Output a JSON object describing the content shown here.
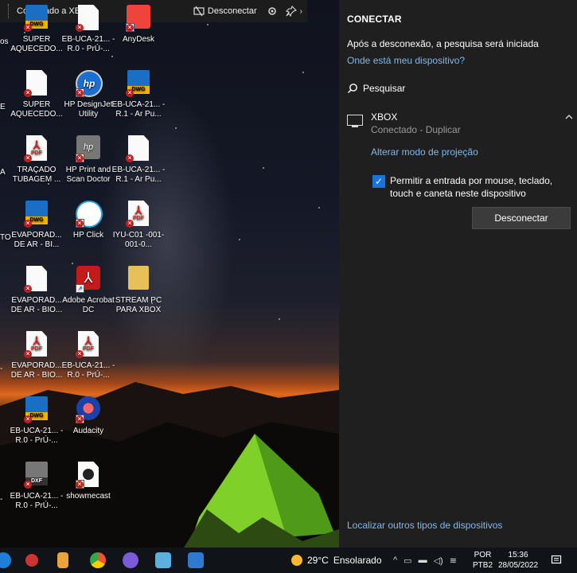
{
  "connect_bar": {
    "title": "Conectado a XBOX",
    "disconnect_label": "Desconectar"
  },
  "desktop_icons": [
    {
      "label": "SUPER AQUECEDO...",
      "type": "dwg"
    },
    {
      "label": "EB-UCA-21... - R.0 - PrÚ-...",
      "type": "doc"
    },
    {
      "label": "AnyDesk",
      "type": "anydesk"
    },
    {
      "label": "SUPER AQUECEDO...",
      "type": "doc"
    },
    {
      "label": "HP DesignJet Utility",
      "type": "hp"
    },
    {
      "label": "EB-UCA-21... - R.1 - Ar Pu...",
      "type": "dwg"
    },
    {
      "label": "TRAÇADO TUBAGEM ...",
      "type": "pdf"
    },
    {
      "label": "HP Print and Scan Doctor",
      "type": "hpdoctor"
    },
    {
      "label": "EB-UCA-21... - R.1 - Ar Pu...",
      "type": "doc"
    },
    {
      "label": "EVAPORAD... DE AR - BI...",
      "type": "dwg"
    },
    {
      "label": "HP Click",
      "type": "hpclick"
    },
    {
      "label": "IYU-C01 -001-001-0...",
      "type": "pdf"
    },
    {
      "label": "EVAPORAD... DE AR - BIO...",
      "type": "doc"
    },
    {
      "label": "Adobe Acrobat DC",
      "type": "acrobat"
    },
    {
      "label": "STREAM PC PARA XBOX",
      "type": "folder"
    },
    {
      "label": "EVAPORAD... DE AR - BIO...",
      "type": "pdf"
    },
    {
      "label": "EB-UCA-21... - R.0 - PrÚ-...",
      "type": "pdf"
    },
    {
      "label": "EB-UCA-21... - R.0 - PrÚ-...",
      "type": "dwg"
    },
    {
      "label": "Audacity",
      "type": "audacity"
    },
    {
      "label": "EB-UCA-21... - R.0 - PrÚ-...",
      "type": "dxf"
    },
    {
      "label": "showmecast",
      "type": "showmecast"
    }
  ],
  "left_edge_fragments": [
    "os",
    "E",
    "A",
    "TO",
    "-",
    "-"
  ],
  "panel": {
    "title": "CONECTAR",
    "info": "Após a desconexão, a pesquisa será iniciada",
    "where_link": "Onde está meu dispositivo?",
    "search_label": "Pesquisar",
    "device_name": "XBOX",
    "device_status": "Conectado - Duplicar",
    "projection_link": "Alterar modo de projeção",
    "checkbox_label": "Permitir a entrada por mouse, teclado, touch e caneta neste dispositivo",
    "checkbox_checked": true,
    "disconnect_button": "Desconectar",
    "other_devices_link": "Localizar outros tipos de dispositivos"
  },
  "taskbar": {
    "weather_temp": "29°C",
    "weather_text": "Ensolarado",
    "lang_top": "POR",
    "lang_bottom": "PTB2",
    "time": "15:36",
    "date": "28/05/2022"
  },
  "colors": {
    "panel_bg": "#1f1f1f",
    "link": "#7fb8ee",
    "accent": "#1a73d8",
    "taskbar_bg": "#101418"
  }
}
